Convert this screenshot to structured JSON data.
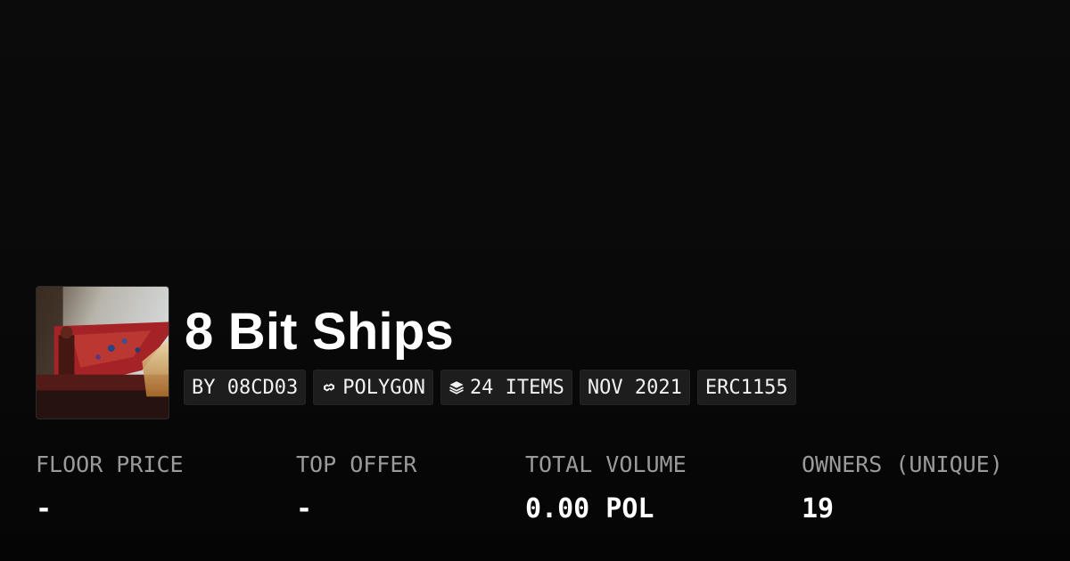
{
  "collection": {
    "name": "8 Bit Ships",
    "thumbnail_icon": "ship-artwork-thumbnail"
  },
  "badges": [
    {
      "label": "BY 08CD03",
      "icon": null
    },
    {
      "label": "POLYGON",
      "icon": "polygon-chain-icon"
    },
    {
      "label": "24 ITEMS",
      "icon": "layers-icon"
    },
    {
      "label": "NOV 2021",
      "icon": null
    },
    {
      "label": "ERC1155",
      "icon": null
    }
  ],
  "stats": {
    "floor_price": {
      "label": "FLOOR PRICE",
      "value": "-"
    },
    "top_offer": {
      "label": "TOP OFFER",
      "value": "-"
    },
    "total_volume": {
      "label": "TOTAL VOLUME",
      "value": "0.00 POL"
    },
    "owners": {
      "label": "OWNERS (UNIQUE)",
      "value": "19"
    }
  },
  "colors": {
    "background": "#0a0a0a",
    "badge_background": "#1d1d1d",
    "label_gray": "#9a9a9a",
    "text_white": "#ffffff"
  }
}
